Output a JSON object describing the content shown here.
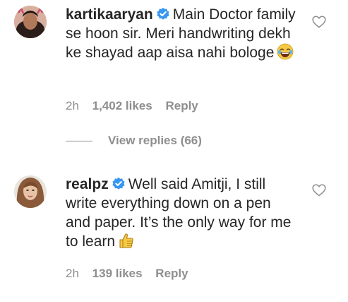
{
  "comments": [
    {
      "username": "kartikaaryan",
      "text": "Main Doctor family se hoon sir. Meri handwriting dekh ke shayad aap aisa nahi bologe",
      "emoji": "laughing-tears-emoji",
      "time": "2h",
      "likes": "1,402 likes",
      "reply": "Reply"
    },
    {
      "username": "realpz",
      "text": "Well said Amitji, I still write everything down on a pen and paper. It’s the only way for me to learn",
      "emoji": "thumbs-up-emoji",
      "time": "2h",
      "likes": "139 likes",
      "reply": "Reply"
    }
  ],
  "view_replies": "View replies (66)",
  "colors": {
    "text": "#262626",
    "secondary": "#8e8e8e",
    "verified": "#3897f0"
  },
  "icons": [
    "heart-outline-icon",
    "verified-badge-icon",
    "avatar"
  ]
}
